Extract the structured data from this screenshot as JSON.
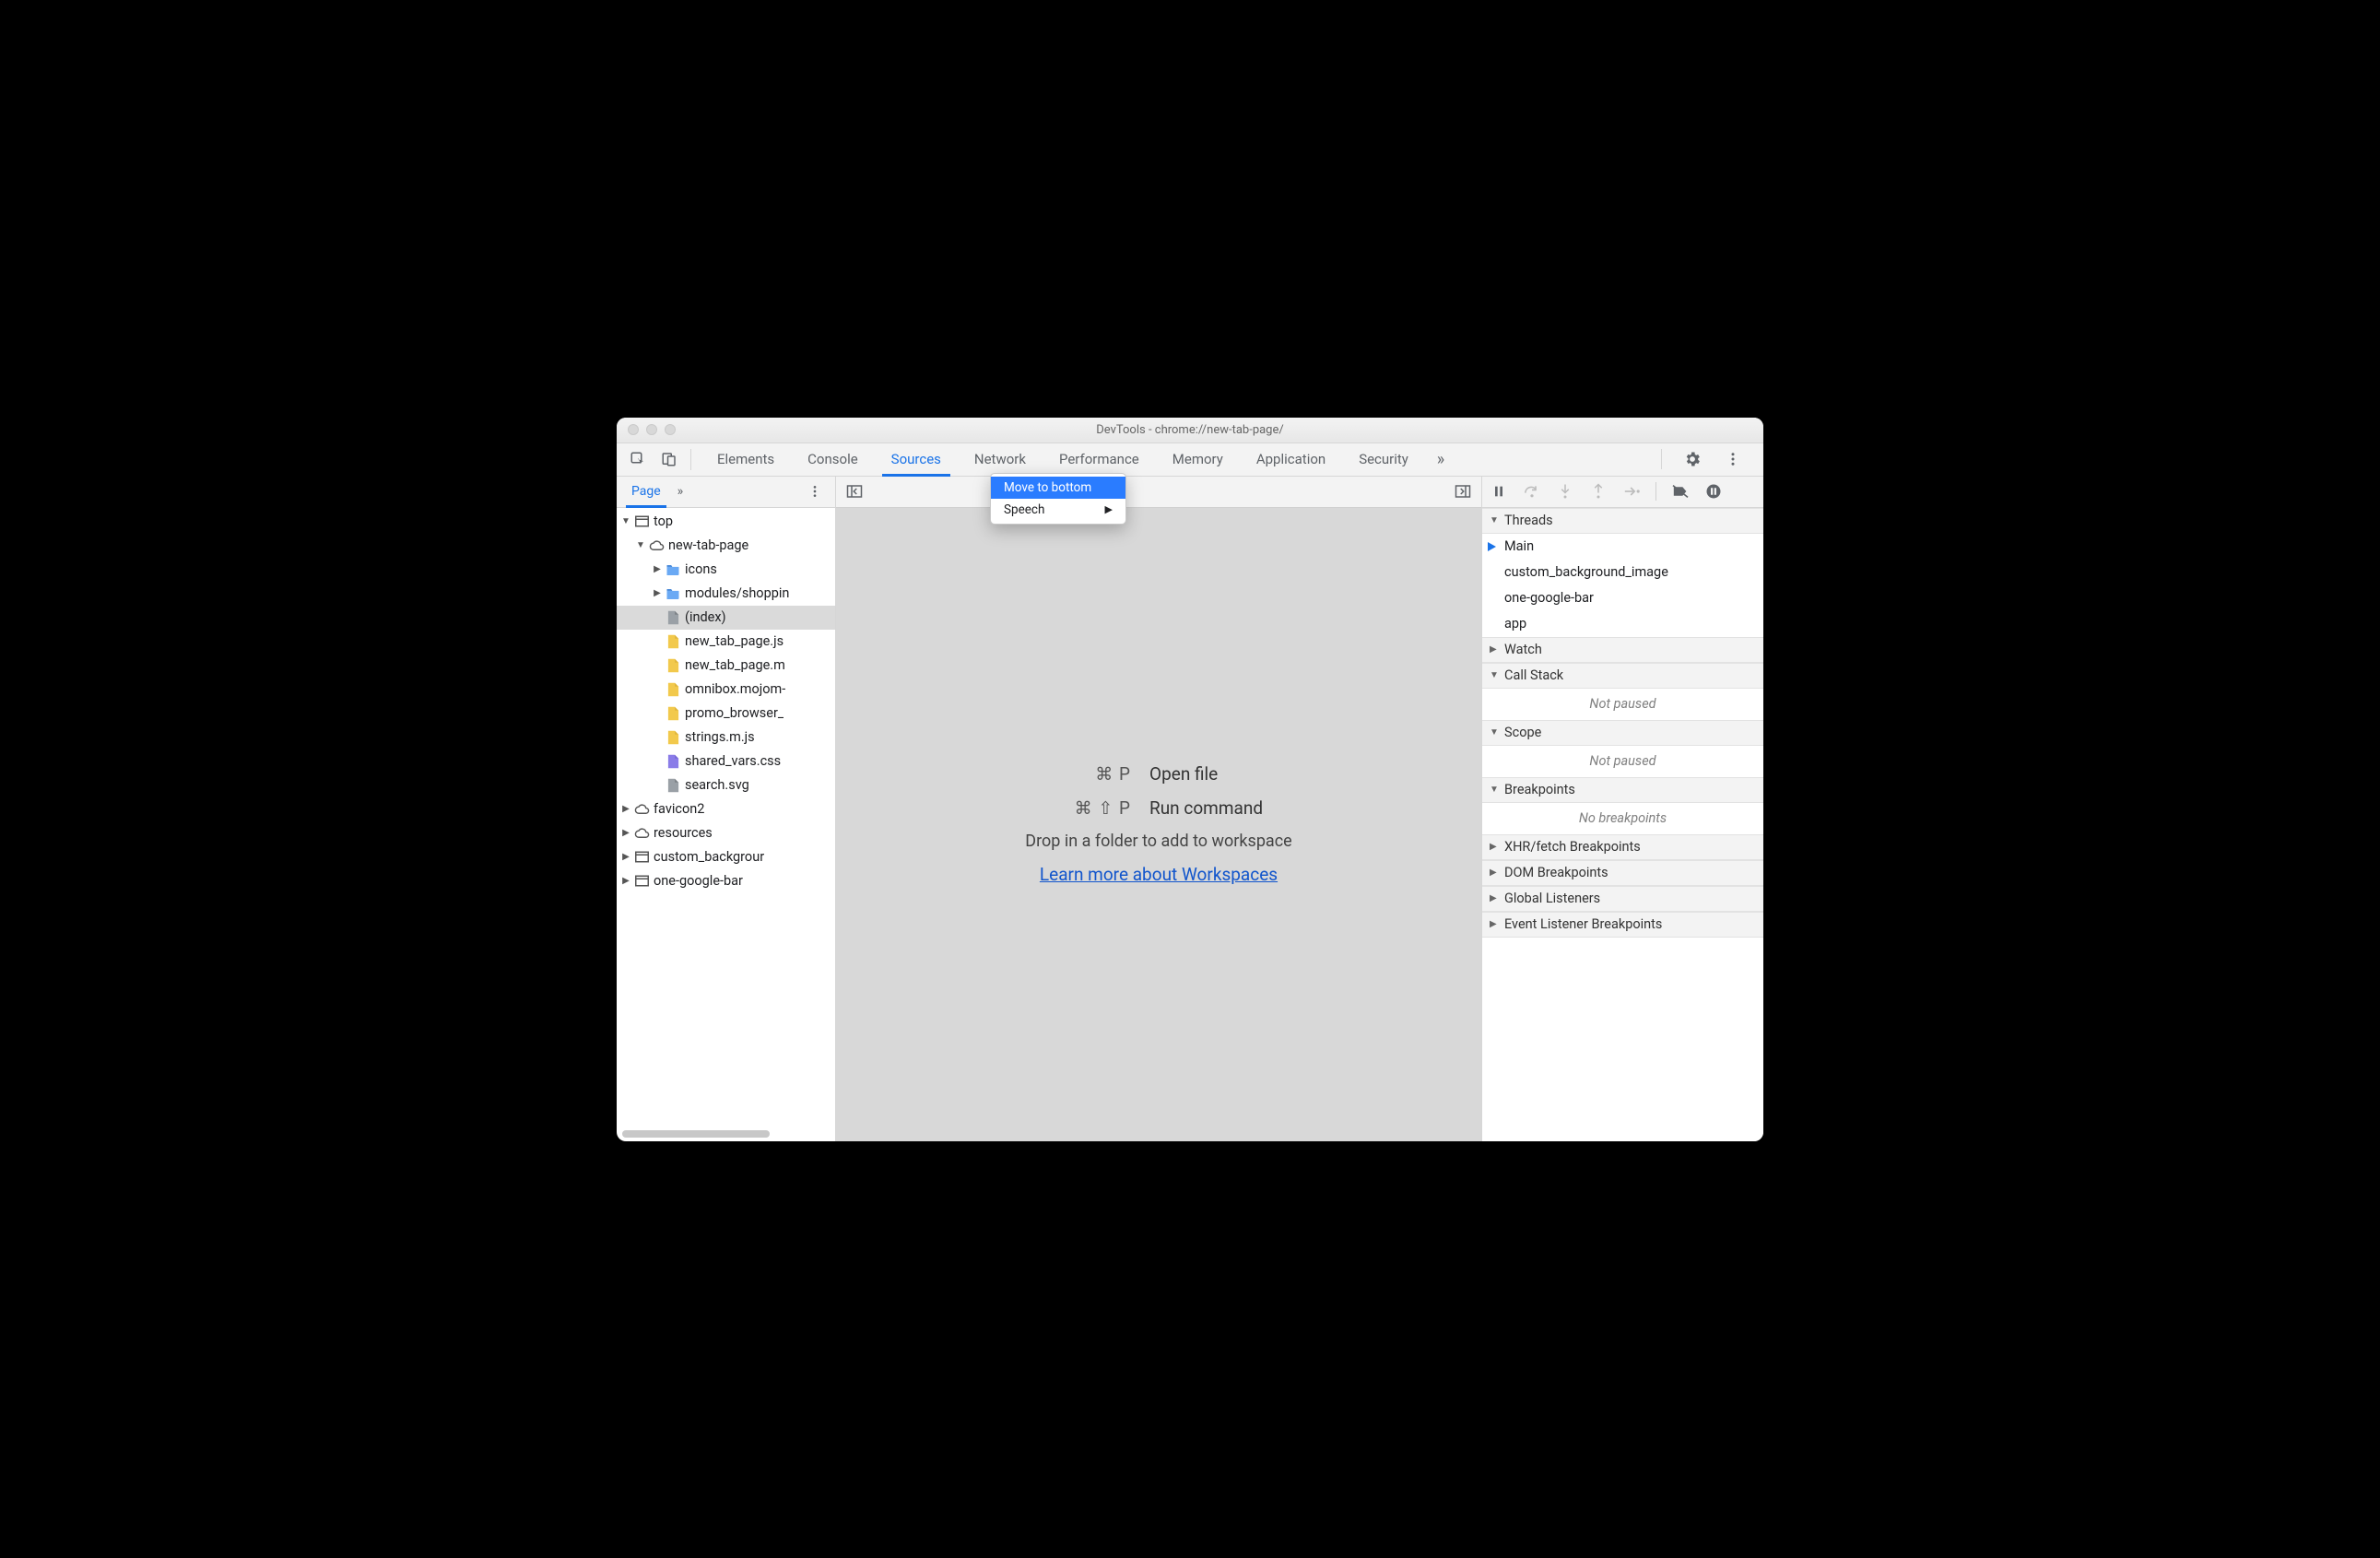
{
  "window": {
    "title": "DevTools - chrome://new-tab-page/"
  },
  "tabs": {
    "items": [
      "Elements",
      "Console",
      "Sources",
      "Network",
      "Performance",
      "Memory",
      "Application",
      "Security"
    ],
    "active": "Sources"
  },
  "context_menu": {
    "items": [
      {
        "label": "Move to bottom",
        "highlighted": true
      },
      {
        "label": "Speech",
        "submenu": true
      }
    ]
  },
  "left": {
    "active_subtab": "Page",
    "tree": [
      {
        "depth": 0,
        "name": "top",
        "icon": "frame",
        "expand": "open"
      },
      {
        "depth": 1,
        "name": "new-tab-page",
        "icon": "cloud",
        "expand": "open"
      },
      {
        "depth": 2,
        "name": "icons",
        "icon": "folder",
        "expand": "closed"
      },
      {
        "depth": 2,
        "name": "modules/shoppin",
        "icon": "folder",
        "expand": "closed"
      },
      {
        "depth": 2,
        "name": "(index)",
        "icon": "doc-gray",
        "selected": true
      },
      {
        "depth": 2,
        "name": "new_tab_page.js",
        "icon": "doc-yellow"
      },
      {
        "depth": 2,
        "name": "new_tab_page.m",
        "icon": "doc-yellow"
      },
      {
        "depth": 2,
        "name": "omnibox.mojom-",
        "icon": "doc-yellow"
      },
      {
        "depth": 2,
        "name": "promo_browser_",
        "icon": "doc-yellow"
      },
      {
        "depth": 2,
        "name": "strings.m.js",
        "icon": "doc-yellow"
      },
      {
        "depth": 2,
        "name": "shared_vars.css",
        "icon": "doc-purple"
      },
      {
        "depth": 2,
        "name": "search.svg",
        "icon": "doc-gray"
      },
      {
        "depth": 0,
        "name": "favicon2",
        "icon": "cloud",
        "expand": "closed"
      },
      {
        "depth": 0,
        "name": "resources",
        "icon": "cloud",
        "expand": "closed"
      },
      {
        "depth": 0,
        "name": "custom_backgrour",
        "icon": "frame",
        "expand": "closed"
      },
      {
        "depth": 0,
        "name": "one-google-bar",
        "icon": "frame",
        "expand": "closed"
      }
    ]
  },
  "center": {
    "shortcuts": [
      {
        "keys": "⌘ P",
        "label": "Open file"
      },
      {
        "keys": "⌘ ⇧ P",
        "label": "Run command"
      }
    ],
    "drop_text": "Drop in a folder to add to workspace",
    "link_text": "Learn more about Workspaces"
  },
  "right": {
    "sections": {
      "threads": {
        "title": "Threads",
        "open": true,
        "items": [
          "Main",
          "custom_background_image",
          "one-google-bar",
          "app"
        ],
        "active": "Main"
      },
      "watch": {
        "title": "Watch",
        "open": false
      },
      "callstack": {
        "title": "Call Stack",
        "open": true,
        "empty": "Not paused"
      },
      "scope": {
        "title": "Scope",
        "open": true,
        "empty": "Not paused"
      },
      "breakpoints": {
        "title": "Breakpoints",
        "open": true,
        "empty": "No breakpoints"
      },
      "xhr": {
        "title": "XHR/fetch Breakpoints",
        "open": false
      },
      "dom": {
        "title": "DOM Breakpoints",
        "open": false
      },
      "global": {
        "title": "Global Listeners",
        "open": false
      },
      "event": {
        "title": "Event Listener Breakpoints",
        "open": false
      }
    }
  }
}
